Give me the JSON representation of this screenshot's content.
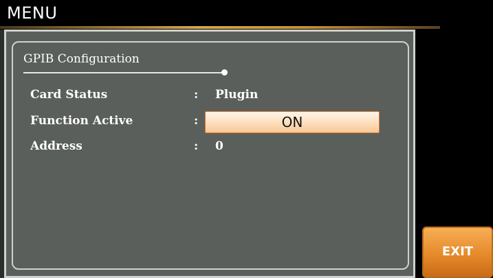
{
  "header": {
    "title": "MENU"
  },
  "section": {
    "title": "GPIB Configuration"
  },
  "rows": [
    {
      "label": "Card Status",
      "value": "Plugin"
    },
    {
      "label": "Function Active",
      "value": "ON"
    },
    {
      "label": "Address",
      "value": "0"
    }
  ],
  "separator": ":",
  "softkeys": {
    "exit_label": "EXIT"
  },
  "colors": {
    "panel_bg": "#5b5f5c",
    "accent_orange": "#e68a2a",
    "header_rule": "#d8a64a"
  }
}
